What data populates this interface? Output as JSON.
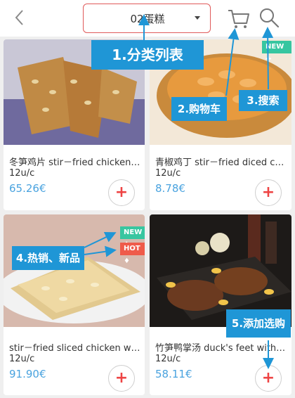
{
  "header": {
    "category_label": "02蛋糕",
    "back_icon": "chevron-left-icon",
    "cart_icon": "cart-icon",
    "search_icon": "search-icon"
  },
  "products": [
    {
      "name": "冬笋鸡片 stir－fried chicken slices",
      "unit": "12u/c",
      "price": "65.26€",
      "add_label": "+"
    },
    {
      "name": "青椒鸡丁 stir－fried diced chicken",
      "unit": "12u/c",
      "price": "8.78€",
      "add_label": "+"
    },
    {
      "name": "stir－fried sliced chicken with",
      "unit": "12u/c",
      "price": "91.90€",
      "add_label": "+"
    },
    {
      "name": "竹笋鸭掌汤 duck's feet with bamboo",
      "unit": "12u/c",
      "price": "58.11€",
      "add_label": "+"
    }
  ],
  "badges": {
    "new_label": "NEW",
    "hot_label": "HOT"
  },
  "annotations": {
    "list": "1.分类列表",
    "cart": "2.购物车",
    "search": "3.搜索",
    "hot_new": "4.热销、新品",
    "add": "5.添加选购"
  },
  "colors": {
    "accent_blue": "#1f96d6",
    "price_blue": "#4aa3df",
    "add_red": "#e44444",
    "badge_new": "#37c6a0",
    "badge_hot": "#ef5b4a"
  }
}
